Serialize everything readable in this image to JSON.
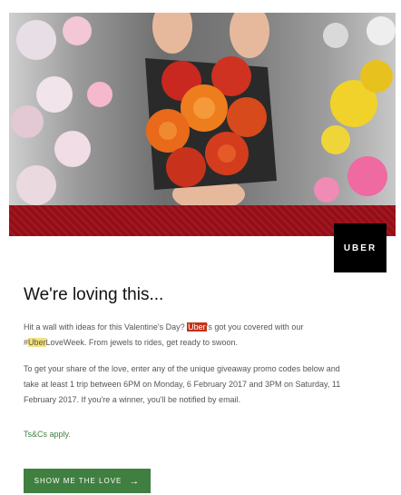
{
  "header": {
    "logo_text": "UBER"
  },
  "main": {
    "title": "We're loving this...",
    "p1_before": "Hit a wall with ideas for this Valentine's Day? ",
    "p1_hl1": "Uber",
    "p1_mid": "'s got you covered with our #",
    "p1_hl2": "Uber",
    "p1_after": "LoveWeek. From jewels to rides, get ready to swoon.",
    "p2": "To get your share of the love, enter any of the unique giveaway promo codes below and take at least 1 trip between 6PM on Monday, 6 February 2017 and 3PM on Saturday, 11 February 2017. If you're a winner, you'll be notified by email.",
    "tcs": "Ts&Cs apply.",
    "cta_label": "SHOW ME THE LOVE"
  },
  "colors": {
    "accent": "#3f7f3f",
    "band": "#a3151f",
    "highlight": "#c3321b"
  },
  "icons": {
    "cta_arrow": "arrow-right-icon"
  }
}
